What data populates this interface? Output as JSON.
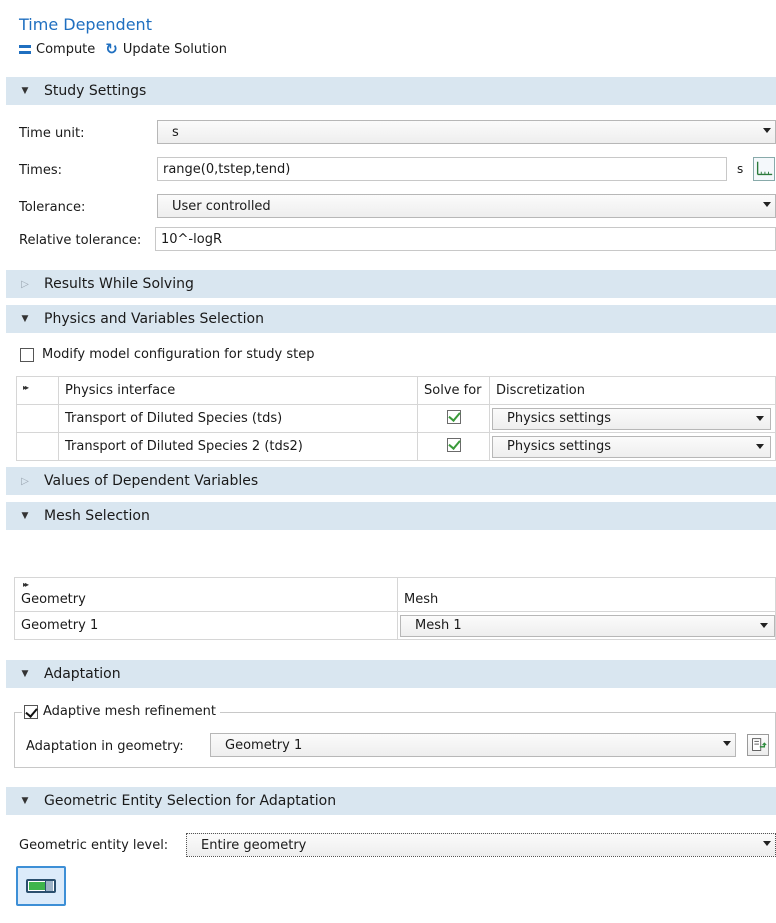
{
  "window_title": "Time Dependent",
  "toolbar": {
    "compute_label": "Compute",
    "update_label": "Update Solution"
  },
  "sections": {
    "study_settings": "Study Settings",
    "results_while_solving": "Results While Solving",
    "physics_vars": "Physics and Variables Selection",
    "values_dep_vars": "Values of Dependent Variables",
    "mesh_selection": "Mesh Selection",
    "adaptation": "Adaptation",
    "geom_entity": "Geometric Entity Selection for Adaptation"
  },
  "study": {
    "time_unit_label": "Time unit:",
    "time_unit_value": "s",
    "times_label": "Times:",
    "times_value": "range(0,tstep,tend)",
    "times_unit": "s",
    "tolerance_label": "Tolerance:",
    "tolerance_value": "User controlled",
    "rel_tol_label": "Relative tolerance:",
    "rel_tol_value": "10^-logR"
  },
  "physics": {
    "modify_label": "Modify model configuration for study step",
    "headers": {
      "interface": "Physics interface",
      "solve_for": "Solve for",
      "discretization": "Discretization"
    },
    "rows": [
      {
        "name": "Transport of Diluted Species (tds)",
        "discretization": "Physics settings"
      },
      {
        "name": "Transport of Diluted Species 2 (tds2)",
        "discretization": "Physics settings"
      }
    ]
  },
  "mesh": {
    "headers": {
      "geometry": "Geometry",
      "mesh": "Mesh"
    },
    "rows": [
      {
        "geometry": "Geometry 1",
        "mesh": "Mesh 1"
      }
    ]
  },
  "adaptation": {
    "checkbox_label": "Adaptive mesh refinement",
    "geom_label": "Adaptation in geometry:",
    "geom_value": "Geometry 1"
  },
  "geom_entity": {
    "level_label": "Geometric entity level:",
    "level_value": "Entire geometry"
  },
  "colors": {
    "accent": "#1f6fc0",
    "section_bg": "#d9e6f0",
    "check_green": "#3a9a3a"
  }
}
